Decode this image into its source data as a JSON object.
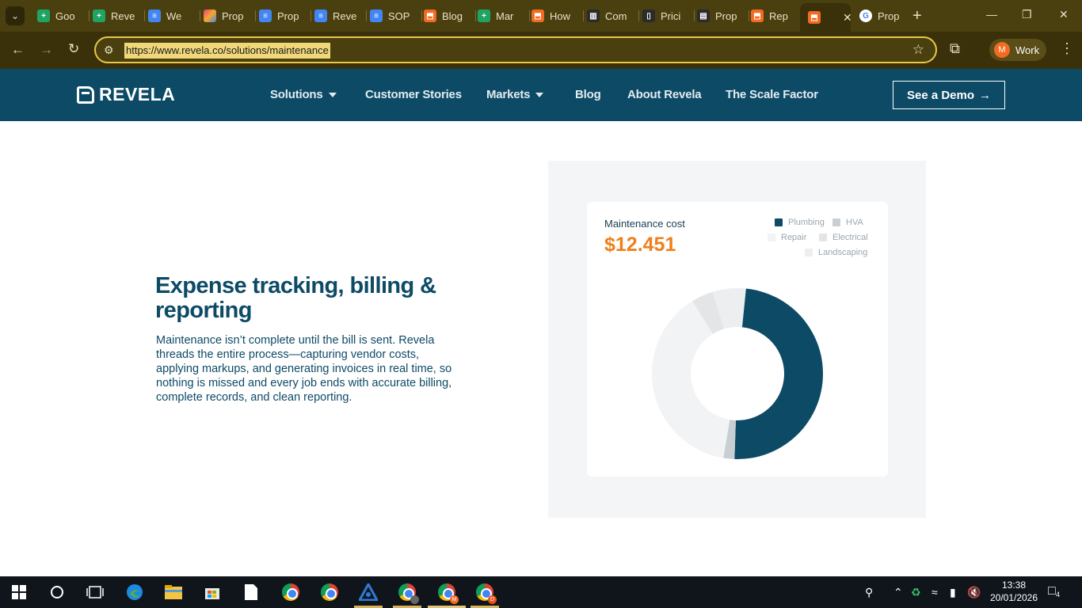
{
  "browser": {
    "tabs": [
      {
        "label": "Goo",
        "favicon": "sheets-icon"
      },
      {
        "label": "Reve",
        "favicon": "sheets-icon"
      },
      {
        "label": "We",
        "favicon": "docs-icon"
      },
      {
        "label": "Prop",
        "favicon": "butterfly-icon"
      },
      {
        "label": "Prop",
        "favicon": "docs-icon"
      },
      {
        "label": "Reve",
        "favicon": "docs-icon"
      },
      {
        "label": "SOP",
        "favicon": "docs-icon"
      },
      {
        "label": "Blog",
        "favicon": "revela-icon"
      },
      {
        "label": "Mar",
        "favicon": "sheets-icon"
      },
      {
        "label": "How",
        "favicon": "revela-icon"
      },
      {
        "label": "Com",
        "favicon": "building-icon"
      },
      {
        "label": "Prici",
        "favicon": "phone-icon"
      },
      {
        "label": "Prop",
        "favicon": "doc-dark-icon"
      },
      {
        "label": "Rep",
        "favicon": "revela-icon"
      },
      {
        "label": "",
        "favicon": "revela-icon",
        "active": true
      },
      {
        "label": "Prop",
        "favicon": "google-icon"
      }
    ],
    "url": "https://www.revela.co/solutions/maintenance",
    "profile_initial": "M",
    "profile_label": "Work"
  },
  "site": {
    "logo_text": "REVELA",
    "nav": [
      {
        "label": "Solutions",
        "dropdown": true
      },
      {
        "label": "Customer Stories",
        "dropdown": false
      },
      {
        "label": "Markets",
        "dropdown": true
      },
      {
        "label": "Blog",
        "dropdown": false
      },
      {
        "label": "About Revela",
        "dropdown": false
      },
      {
        "label": "The Scale Factor",
        "dropdown": false
      }
    ],
    "demo_button": "See a Demo",
    "demo_arrow": "→"
  },
  "content": {
    "heading": "Expense tracking, billing & reporting",
    "body": "Maintenance isn’t complete until the bill is sent. Revela threads the entire process—capturing vendor costs, applying markups, and generating invoices in real time, so nothing is missed and every job ends with accurate billing, complete records, and clean reporting."
  },
  "widget": {
    "label": "Maintenance cost",
    "value": "$12.451",
    "legend": [
      "Plumbing",
      "HVA",
      "Repair",
      "Electrical",
      "Landscaping"
    ]
  },
  "chart_data": {
    "type": "pie",
    "donut": true,
    "categories": [
      "Plumbing",
      "HVA",
      "Repair",
      "Electrical",
      "Landscaping"
    ],
    "values": [
      47,
      2,
      37,
      4,
      6
    ],
    "colors": [
      "#0d4a66",
      "#c9ced2",
      "#f1f3f4",
      "#e3e5e6",
      "#eceef0"
    ]
  },
  "taskbar": {
    "time": "13:38",
    "date": "20/01/2026",
    "notifications": "4"
  },
  "colors": {
    "brand_navy": "#0d4a66",
    "accent_orange": "#f07f1b",
    "chrome_frame": "#4a3f0f"
  }
}
